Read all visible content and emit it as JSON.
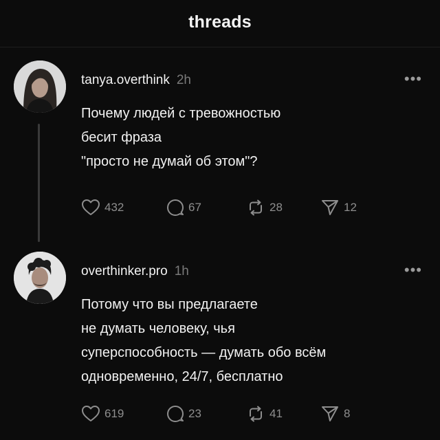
{
  "header": {
    "title": "threads"
  },
  "posts": [
    {
      "username": "tanya.overthink",
      "time": "2h",
      "text_lines": [
        "Почему людей с тревожностью",
        "бесит фраза",
        "\"просто не думай об этом\"?"
      ],
      "likes": "432",
      "comments": "67",
      "reposts": "28",
      "shares": "12",
      "more_icon": "more-horizontal-icon"
    },
    {
      "username": "overthinker.pro",
      "time": "1h",
      "text_lines": [
        "Потому что вы предлагаете",
        "не думать человеку, чья",
        "суперспособность — думать обо всём",
        "одновременно, 24/7, бесплатно"
      ],
      "likes": "619",
      "comments": "23",
      "reposts": "41",
      "shares": "8",
      "more_icon": "more-horizontal-icon"
    }
  ],
  "icons": {
    "like": "heart-icon",
    "comment": "comment-icon",
    "repost": "repost-icon",
    "share": "send-icon"
  },
  "colors": {
    "background": "#0c0c0c",
    "text": "#f2f2f2",
    "muted": "#8e8e8e",
    "thread_line": "#3a3a3a"
  }
}
